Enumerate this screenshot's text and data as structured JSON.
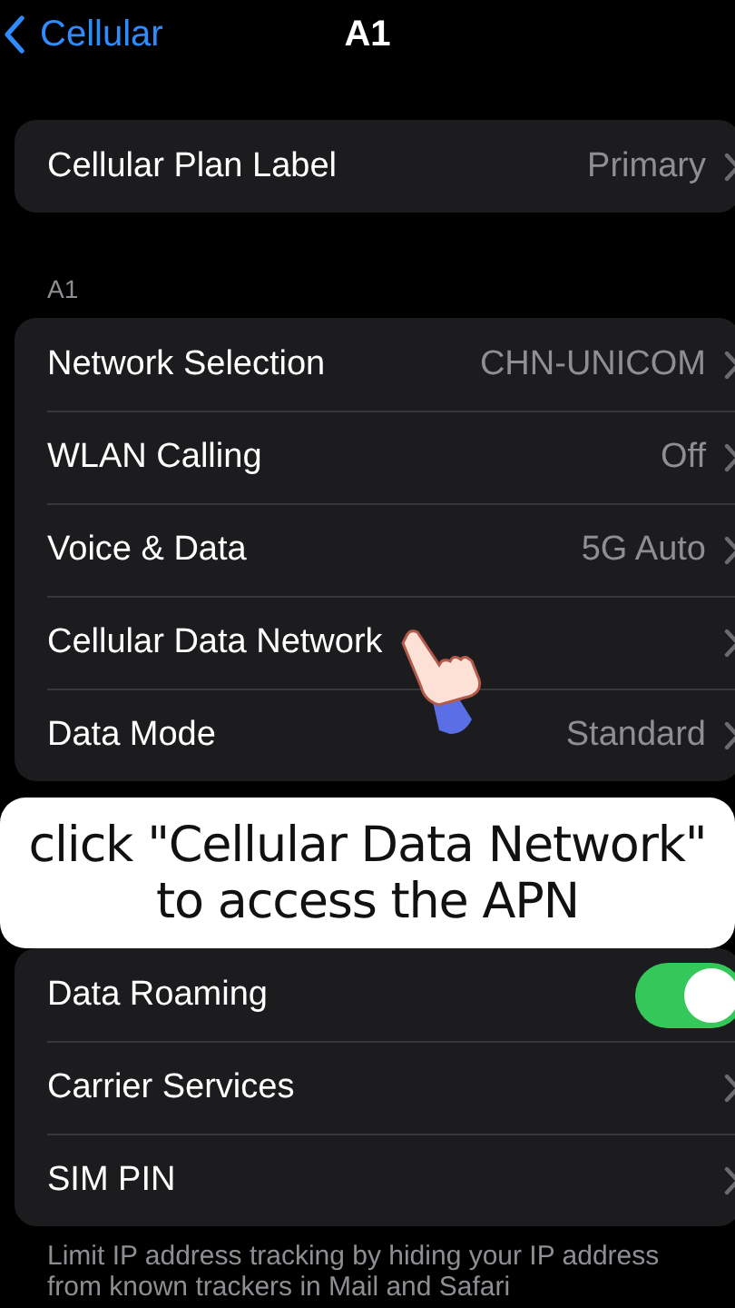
{
  "nav": {
    "back": "Cellular",
    "title": "A1"
  },
  "groups": [
    {
      "rows": [
        {
          "kind": "link",
          "label": "Cellular Plan Label",
          "value": "Primary"
        }
      ]
    },
    {
      "header": "A1",
      "rows": [
        {
          "kind": "link",
          "label": "Network Selection",
          "value": "CHN-UNICOM"
        },
        {
          "kind": "link",
          "label": "WLAN Calling",
          "value": "Off"
        },
        {
          "kind": "link",
          "label": "Voice & Data",
          "value": "5G Auto"
        },
        {
          "kind": "link",
          "label": "Cellular Data Network"
        },
        {
          "kind": "link",
          "label": "Data Mode",
          "value": "Standard"
        }
      ]
    },
    {
      "rows": [
        {
          "kind": "toggle",
          "label": "Data Roaming",
          "on": true
        },
        {
          "kind": "link",
          "label": "Carrier Services"
        },
        {
          "kind": "link",
          "label": "SIM PIN"
        }
      ]
    }
  ],
  "footer": "Limit IP address tracking by hiding your IP address from known trackers in Mail and Safari",
  "caption": {
    "line1": "click \"Cellular Data Network\"",
    "line2": "to access the APN"
  }
}
